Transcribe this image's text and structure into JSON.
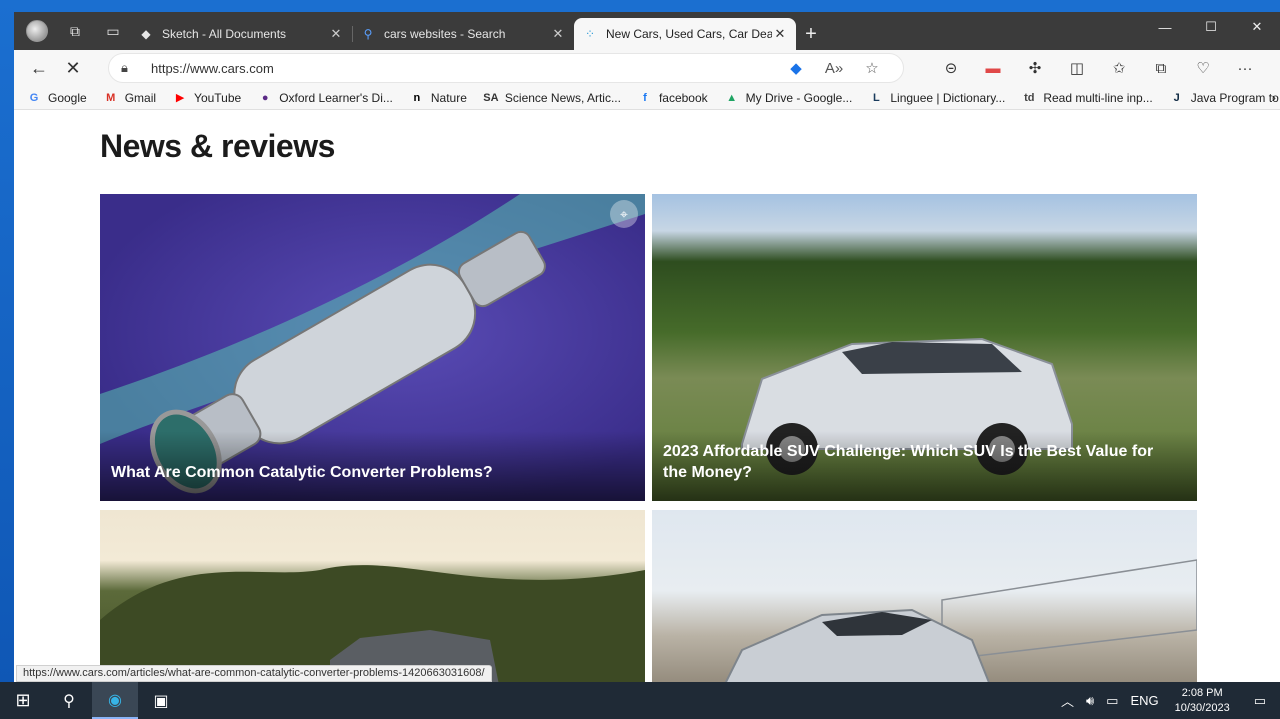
{
  "tabs": [
    {
      "title": "Sketch - All Documents",
      "icon": "sketch-icon"
    },
    {
      "title": "cars websites - Search",
      "icon": "search-icon"
    },
    {
      "title": "New Cars, Used Cars, Car Dealers",
      "icon": "cars-favicon",
      "active": true
    }
  ],
  "address": {
    "url": "https://www.cars.com"
  },
  "bookmarks": [
    {
      "label": "Google",
      "icon": "G",
      "color": "#4285f4"
    },
    {
      "label": "Gmail",
      "icon": "M",
      "color": "#d93025"
    },
    {
      "label": "YouTube",
      "icon": "▶",
      "color": "#ff0000"
    },
    {
      "label": "Oxford Learner's Di...",
      "icon": "●",
      "color": "#5b2a86"
    },
    {
      "label": "Nature",
      "icon": "n",
      "color": "#000000"
    },
    {
      "label": "Science News, Artic...",
      "icon": "SA",
      "color": "#333333"
    },
    {
      "label": "facebook",
      "icon": "f",
      "color": "#1877f2"
    },
    {
      "label": "My Drive - Google...",
      "icon": "▲",
      "color": "#1fa463"
    },
    {
      "label": "Linguee | Dictionary...",
      "icon": "L",
      "color": "#1a3b5d"
    },
    {
      "label": "Read multi-line inp...",
      "icon": "td",
      "color": "#444444"
    },
    {
      "label": "Java Program to Cr...",
      "icon": "J",
      "color": "#102a43"
    }
  ],
  "page": {
    "heading": "News & reviews",
    "articles": [
      {
        "title": "What Are Common Catalytic Converter Problems?"
      },
      {
        "title": "2023 Affordable SUV Challenge: Which SUV Is the Best Value for the Money?"
      },
      {
        "title": ""
      },
      {
        "title": ""
      }
    ]
  },
  "status_url": "https://www.cars.com/articles/what-are-common-catalytic-converter-problems-1420663031608/",
  "taskbar": {
    "lang": "ENG",
    "time": "2:08 PM",
    "date": "10/30/2023"
  }
}
